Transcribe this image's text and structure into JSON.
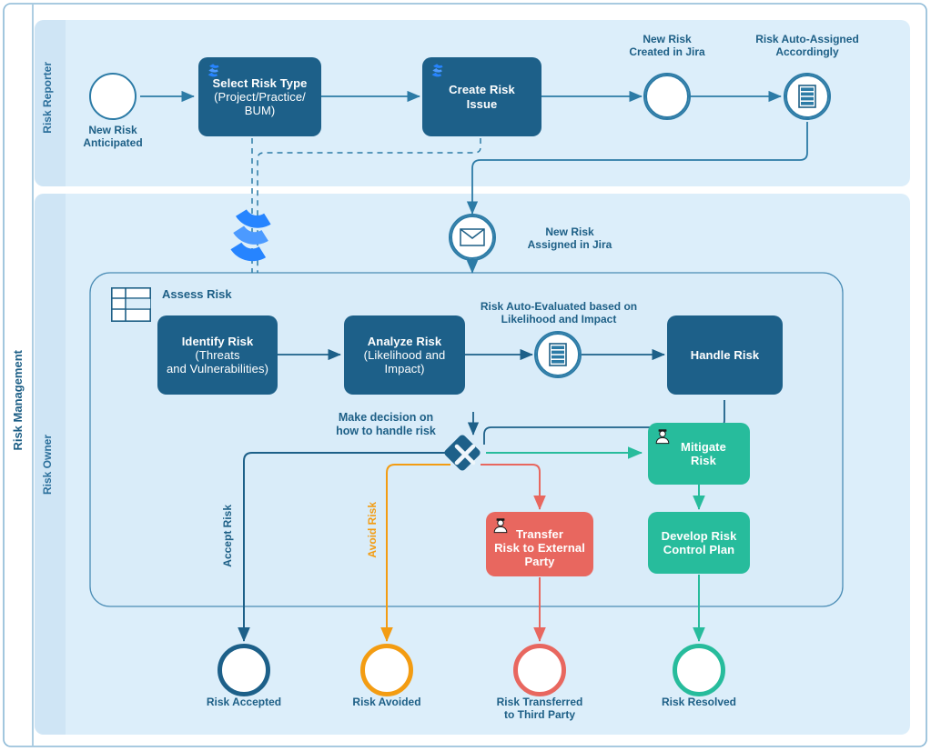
{
  "diagram": {
    "pool_label": "Risk Management",
    "lanes": [
      {
        "label": "Risk Reporter"
      },
      {
        "label": "Risk Owner"
      }
    ],
    "subprocess": {
      "label": "Assess Risk",
      "icon": "table-icon"
    }
  },
  "colors": {
    "blue_task": "#1d6089",
    "blue_stroke": "#2c7ba6",
    "blue_text": "#1d5f86",
    "green": "#27bc9c",
    "red": "#e8675f",
    "orange": "#f39c12",
    "lane_fill": "#dceefa",
    "lane_fill_alt": "#d9ecf9",
    "jira_blue": "#2684ff"
  },
  "events": {
    "start_new_risk": {
      "label": "New Risk\nAnticipated",
      "type": "start-event"
    },
    "new_risk_created": {
      "label": "New Risk\nCreated in Jira",
      "type": "intermediate-event"
    },
    "risk_auto_assigned": {
      "label": "Risk Auto-Assigned\nAccordingly",
      "type": "intermediate-service-event"
    },
    "new_risk_assigned": {
      "label": "New Risk\nAssigned in Jira",
      "type": "intermediate-message-event"
    },
    "risk_auto_evaluated": {
      "label": "Risk Auto-Evaluated based on\nLikelihood and Impact",
      "type": "intermediate-service-event"
    }
  },
  "tasks": {
    "select_risk_type": {
      "line1": "Select Risk Type",
      "line2": "(Project/Practice/\nBUM)",
      "icon": "jira-icon",
      "color": "blue"
    },
    "create_risk_issue": {
      "line1": "Create Risk\nIssue",
      "line2": "",
      "icon": "jira-icon",
      "color": "blue"
    },
    "identify_risk": {
      "line1": "Identify Risk",
      "line2": "(Threats\nand Vulnerabilities)",
      "icon": "",
      "color": "blue"
    },
    "analyze_risk": {
      "line1": "Analyze Risk",
      "line2": "(Likelihood and\nImpact)",
      "icon": "",
      "color": "blue"
    },
    "handle_risk": {
      "line1": "Handle Risk",
      "line2": "",
      "icon": "",
      "color": "blue"
    },
    "mitigate_risk": {
      "line1": "Mitigate\nRisk",
      "line2": "",
      "icon": "user-icon",
      "color": "green"
    },
    "develop_risk_control_plan": {
      "line1": "Develop Risk\nControl Plan",
      "line2": "",
      "icon": "",
      "color": "green"
    },
    "transfer_risk": {
      "line1": "Transfer\nRisk to External\nParty",
      "line2": "",
      "icon": "user-icon",
      "color": "red"
    }
  },
  "gateway": {
    "label": "Make decision on\nhow to handle risk",
    "type": "exclusive-gateway"
  },
  "flow_labels": {
    "accept_risk": "Accept Risk",
    "avoid_risk": "Avoid Risk"
  },
  "end_events": {
    "risk_accepted": {
      "label": "Risk  Accepted",
      "color": "#1d6089"
    },
    "risk_avoided": {
      "label": "Risk Avoided",
      "color": "#f39c12"
    },
    "risk_transferred": {
      "label": "Risk Transferred\nto Third Party",
      "color": "#e8675f"
    },
    "risk_resolved": {
      "label": "Risk Resolved",
      "color": "#27bc9c"
    }
  },
  "artifacts": {
    "jira_logo": "jira-logo-icon"
  }
}
